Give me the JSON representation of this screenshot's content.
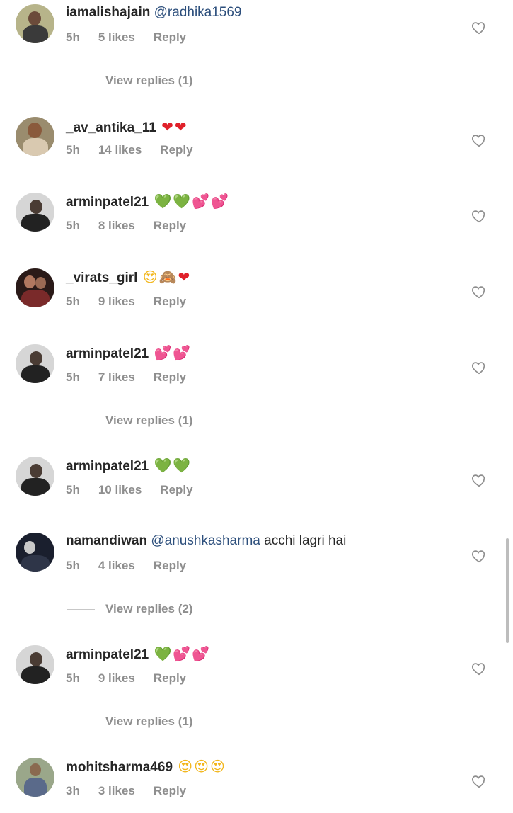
{
  "comments": [
    {
      "username": "iamalishajain",
      "mention": "@radhika1569",
      "text": "",
      "emojis": [],
      "time": "5h",
      "likes": "5 likes",
      "reply": "Reply"
    },
    {
      "username": "_av_antika_11",
      "mention": "",
      "text": "",
      "emojis": [
        {
          "char": "❤",
          "color": "red"
        },
        {
          "char": "❤",
          "color": "red"
        }
      ],
      "time": "5h",
      "likes": "14 likes",
      "reply": "Reply"
    },
    {
      "username": "arminpatel21",
      "mention": "",
      "text": "",
      "emojis": [
        {
          "char": "💚",
          "color": "green"
        },
        {
          "char": "💚",
          "color": "green"
        },
        {
          "char": "💕",
          "color": "pink"
        },
        {
          "char": "💕",
          "color": "pink"
        }
      ],
      "time": "5h",
      "likes": "8 likes",
      "reply": "Reply"
    },
    {
      "username": "_virats_girl",
      "mention": "",
      "text": "",
      "emojis": [
        {
          "char": "😍",
          "color": "face"
        },
        {
          "char": "🙈",
          "color": "face"
        },
        {
          "char": "❤",
          "color": "red"
        }
      ],
      "time": "5h",
      "likes": "9 likes",
      "reply": "Reply"
    },
    {
      "username": "arminpatel21",
      "mention": "",
      "text": "",
      "emojis": [
        {
          "char": "💕",
          "color": "pink"
        },
        {
          "char": "💕",
          "color": "pink"
        }
      ],
      "time": "5h",
      "likes": "7 likes",
      "reply": "Reply"
    },
    {
      "username": "arminpatel21",
      "mention": "",
      "text": "",
      "emojis": [
        {
          "char": "💚",
          "color": "green"
        },
        {
          "char": "💚",
          "color": "green"
        }
      ],
      "time": "5h",
      "likes": "10 likes",
      "reply": "Reply"
    },
    {
      "username": "namandiwan",
      "mention": "@anushkasharma",
      "text": "acchi lagri hai",
      "emojis": [],
      "time": "5h",
      "likes": "4 likes",
      "reply": "Reply"
    },
    {
      "username": "arminpatel21",
      "mention": "",
      "text": "",
      "emojis": [
        {
          "char": "💚",
          "color": "green"
        },
        {
          "char": "💕",
          "color": "pink"
        },
        {
          "char": "💕",
          "color": "pink"
        }
      ],
      "time": "5h",
      "likes": "9 likes",
      "reply": "Reply"
    },
    {
      "username": "mohitsharma469",
      "mention": "",
      "text": "",
      "emojis": [
        {
          "char": "😍",
          "color": "face"
        },
        {
          "char": "😍",
          "color": "face"
        },
        {
          "char": "😍",
          "color": "face"
        }
      ],
      "time": "3h",
      "likes": "3 likes",
      "reply": "Reply"
    }
  ],
  "view_replies": [
    {
      "label": "View replies (1)"
    },
    {
      "label": "View replies (1)"
    },
    {
      "label": "View replies (2)"
    },
    {
      "label": "View replies (1)"
    }
  ],
  "colors": {
    "username": "#262626",
    "mention": "#2d4f7c",
    "meta": "#8e8e8e",
    "heart_outline": "#8e8e8e"
  },
  "icons": {
    "like": "heart-outline-icon"
  }
}
